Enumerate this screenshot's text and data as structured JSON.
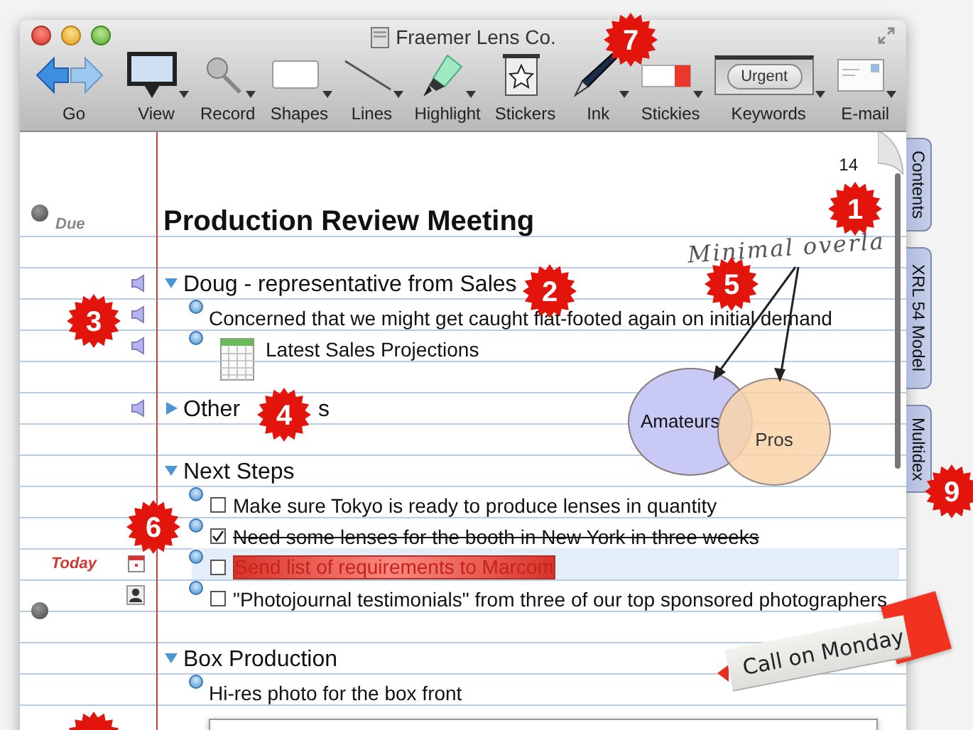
{
  "window": {
    "title": "Fraemer Lens Co."
  },
  "toolbar": [
    {
      "kind": "go",
      "label": "Go",
      "menu": false
    },
    {
      "kind": "view",
      "label": "View",
      "menu": true
    },
    {
      "kind": "record",
      "label": "Record",
      "menu": true
    },
    {
      "kind": "shapes",
      "label": "Shapes",
      "menu": true
    },
    {
      "kind": "lines",
      "label": "Lines",
      "menu": true
    },
    {
      "kind": "highlight",
      "label": "Highlight",
      "menu": true
    },
    {
      "kind": "stickers",
      "label": "Stickers",
      "menu": false
    },
    {
      "kind": "ink",
      "label": "Ink",
      "menu": true
    },
    {
      "kind": "stickies",
      "label": "Stickies",
      "menu": true
    },
    {
      "kind": "keywords",
      "label": "Keywords",
      "menu": true,
      "tag": "Urgent"
    },
    {
      "kind": "email",
      "label": "E-mail",
      "menu": true
    }
  ],
  "page": {
    "number": "14",
    "title": "Production Review Meeting",
    "due": "Due",
    "marker": true
  },
  "outline": [
    {
      "text": "Doug - representative from Sales",
      "expanded": true,
      "audio": true,
      "children": [
        {
          "kind": "note",
          "text": "Concerned that we might get caught flat-footed again on initial demand",
          "audio": true
        },
        {
          "kind": "attachment",
          "text": "Latest Sales Projections",
          "audio": true
        }
      ]
    },
    {
      "text": "Other",
      "text_after_callout": "s",
      "expanded": false,
      "audio": true
    },
    {
      "text": "Next Steps",
      "expanded": true,
      "children": [
        {
          "kind": "todo",
          "text": "Make sure Tokyo is ready to produce lenses in quantity",
          "checked": false,
          "selected": false
        },
        {
          "kind": "todo",
          "text": "Need some lenses for the booth in New York in three weeks",
          "checked": true,
          "selected": false
        },
        {
          "kind": "todo",
          "text": "Send list of requirements to Marcom",
          "checked": false,
          "selected": true,
          "due": "Today"
        },
        {
          "kind": "todo",
          "text": "\"Photojournal testimonials\" from three of our top sponsored photographers",
          "checked": false,
          "selected": false,
          "contact": true,
          "marker": true
        }
      ]
    },
    {
      "text": "Box Production",
      "expanded": true,
      "children": [
        {
          "kind": "note",
          "text": "Hi-res photo for the box front"
        }
      ]
    }
  ],
  "diagram": {
    "note": "Minimal overla",
    "circles": [
      {
        "label": "Amateurs",
        "color": "#c9c9f5"
      },
      {
        "label": "Pros",
        "color": "#f9d4a9"
      }
    ]
  },
  "sticky": {
    "text": "Call on Monday"
  },
  "side_tabs": [
    {
      "label": "Contents"
    },
    {
      "label": "XRL 54 Model"
    },
    {
      "label": "Multidex"
    }
  ],
  "callouts": [
    "1",
    "2",
    "3",
    "4",
    "5",
    "6",
    "7",
    "9"
  ]
}
